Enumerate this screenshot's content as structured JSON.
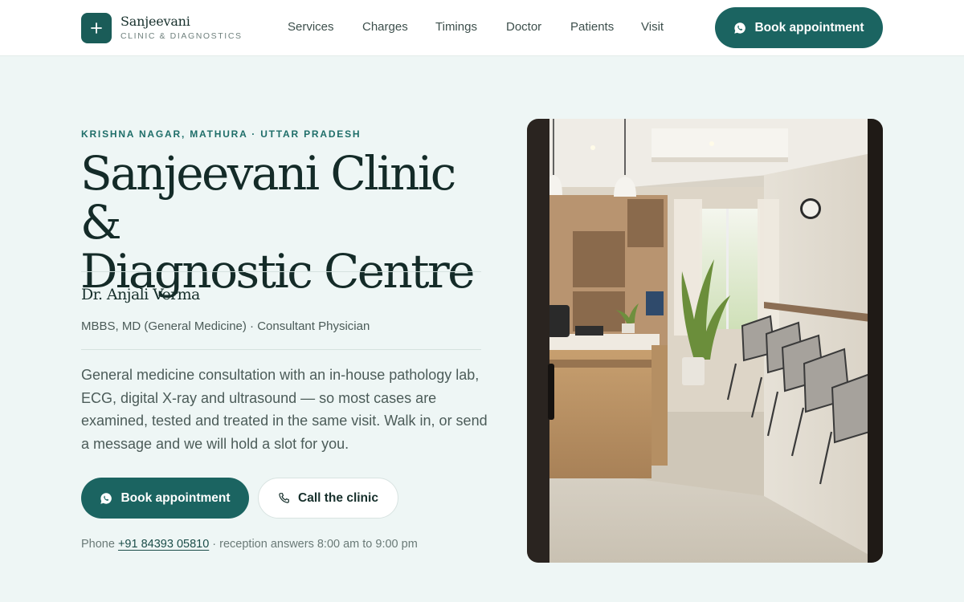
{
  "brand": {
    "name": "Sanjeevani",
    "subtitle": "CLINIC & DIAGNOSTICS",
    "logo_icon": "plus-icon"
  },
  "nav": {
    "items": [
      "Services",
      "Charges",
      "Timings",
      "Doctor",
      "Patients",
      "Visit"
    ]
  },
  "header": {
    "cta_label": "Book appointment",
    "cta_icon": "whatsapp-icon"
  },
  "hero": {
    "eyebrow": "KRISHNA NAGAR, MATHURA · UTTAR PRADESH",
    "title_line1": "Sanjeevani Clinic &",
    "title_line2": "Diagnostic Centre",
    "doctor_name": "Dr. Anjali Verma",
    "doctor_credentials": "MBBS, MD (General Medicine) · Consultant Physician",
    "description": "General medicine consultation with an in-house pathology lab, ECG, digital X-ray and ultrasound — so most cases are examined, tested and treated in the same visit. Walk in, or send a message and we will hold a slot for you.",
    "primary_button": "Book appointment",
    "secondary_button": "Call the clinic",
    "secondary_icon": "phone-icon",
    "phone_prefix": "Phone",
    "phone_number": "+91 84393 05810",
    "phone_suffix": "· reception answers 8:00 am to 9:00 pm"
  },
  "colors": {
    "brand": "#1b6461",
    "background": "#eef6f5",
    "heading": "#142b28"
  }
}
